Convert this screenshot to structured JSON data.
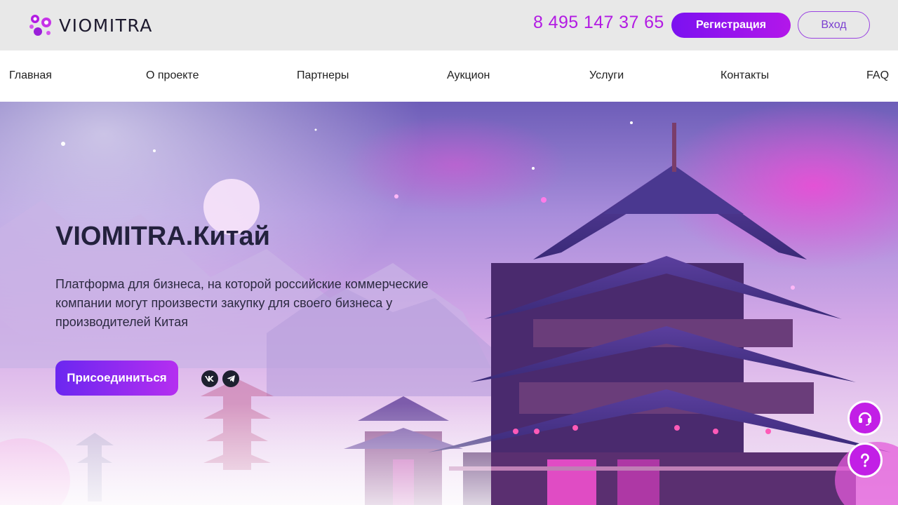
{
  "header": {
    "logo_text": "VIOMITRA",
    "phone": "8 495 147 37 65",
    "register_label": "Регистрация",
    "login_label": "Вход"
  },
  "nav": {
    "items": [
      {
        "label": "Главная"
      },
      {
        "label": "О проекте"
      },
      {
        "label": "Партнеры"
      },
      {
        "label": "Аукцион"
      },
      {
        "label": "Услуги"
      },
      {
        "label": "Контакты"
      },
      {
        "label": "FAQ"
      }
    ]
  },
  "hero": {
    "title": "VIOMITRA.Китай",
    "description": "Платформа для бизнеса, на которой российские коммерческие компании могут произвести закупку для своего бизнеса у производителей Китая",
    "join_label": "Присоединиться",
    "social_icons": [
      "vk-icon",
      "telegram-icon"
    ]
  },
  "floating": {
    "support_icon": "headset-icon",
    "help_icon": "question-icon"
  },
  "colors": {
    "brand": "#b21be3",
    "button_gradient_start": "#6b27f0",
    "button_gradient_end": "#b52ef0",
    "fab": "#c21fe6"
  }
}
